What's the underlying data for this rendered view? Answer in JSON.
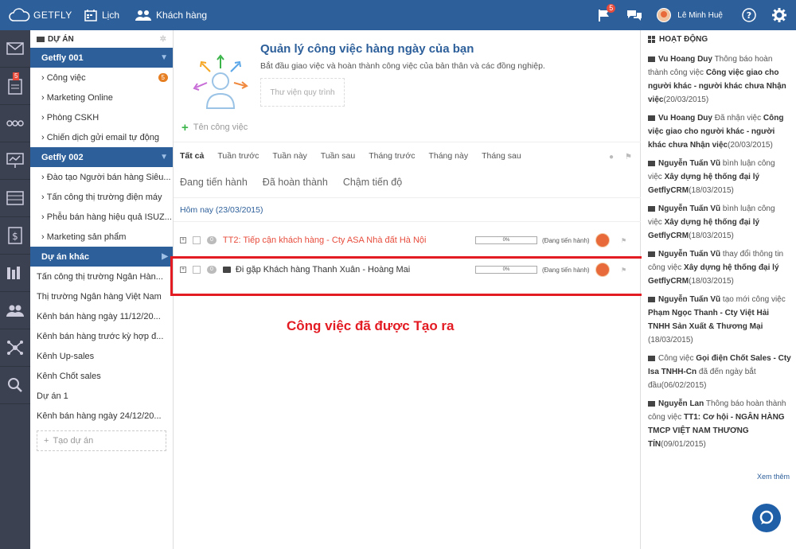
{
  "topbar": {
    "brand": "GETFLY",
    "nav": [
      {
        "label": "Lịch",
        "icon": "calendar-icon"
      },
      {
        "label": "Khách hàng",
        "icon": "customers-icon"
      }
    ],
    "flag_badge": "5",
    "user_name": "Lê Minh Huệ"
  },
  "rail": {
    "badge": "5"
  },
  "sidebar": {
    "title": "DỰ ÁN",
    "groups": [
      {
        "label": "Getfly 001",
        "items": [
          {
            "label": "Công việc",
            "count": "5"
          },
          {
            "label": "Marketing Online"
          },
          {
            "label": "Phòng CSKH"
          },
          {
            "label": "Chiến dịch gửi email tự động"
          }
        ]
      },
      {
        "label": "Getfly 002",
        "items": [
          {
            "label": "Đào tạo Người bán hàng Siêu..."
          },
          {
            "label": "Tấn công thị trường điện máy"
          },
          {
            "label": "Phễu bán hàng hiệu quả ISUZ..."
          },
          {
            "label": "Marketing sản phẩm"
          }
        ]
      },
      {
        "label": "Dự án khác",
        "items": [
          {
            "label": "Tấn công thị trường Ngân Hàn..."
          },
          {
            "label": "Thị trường Ngân hàng Việt Nam"
          },
          {
            "label": "Kênh bán hàng ngày 11/12/20..."
          },
          {
            "label": "Kênh bán hàng trước kỳ hợp đ..."
          },
          {
            "label": "Kênh Up-sales"
          },
          {
            "label": "Kênh Chốt sales"
          },
          {
            "label": "Dự án 1"
          },
          {
            "label": "Kênh bán hàng ngày 24/12/20..."
          }
        ]
      }
    ],
    "add_project": "Tạo dự án"
  },
  "main": {
    "hero_title": "Quản lý công việc hàng ngày của bạn",
    "hero_sub": "Bắt đầu giao việc và hoàn thành công việc của bản thân và các đồng nghiệp.",
    "hero_button": "Thư viện quy trình",
    "task_placeholder": "Tên công việc",
    "filter_tabs": [
      "Tất cả",
      "Tuần trước",
      "Tuần này",
      "Tuần sau",
      "Tháng trước",
      "Tháng này",
      "Tháng sau"
    ],
    "status_tabs": [
      "Đang tiến hành",
      "Đã hoàn thành",
      "Chậm tiến độ"
    ],
    "day_label": "Hôm nay (23/03/2015)",
    "tasks": [
      {
        "name": "TT2: Tiếp cận khách hàng - Cty ASA Nhà đất Hà Nội",
        "count": "0",
        "progress": "0%",
        "status": "(Đang tiến hành)",
        "color": "#e74c3c"
      },
      {
        "name": "Đi gặp Khách hàng Thanh Xuân - Hoàng Mai",
        "count": "0",
        "progress": "0%",
        "status": "(Đang tiến hành)",
        "color": "#333333"
      }
    ],
    "created_note": "Công việc đã được Tạo ra"
  },
  "activity": {
    "title": "HOẠT ĐỘNG",
    "items": [
      [
        {
          "t": "Vu Hoang Duy",
          "b": true
        },
        {
          "t": " Thông báo hoàn thành công việc "
        },
        {
          "t": "Công việc giao cho người khác - người khác chưa Nhận việc",
          "b": true
        },
        {
          "t": "(20/03/2015)"
        }
      ],
      [
        {
          "t": "Vu Hoang Duy",
          "b": true
        },
        {
          "t": " Đã nhận việc "
        },
        {
          "t": "Công việc giao cho người khác - người khác chưa Nhận việc",
          "b": true
        },
        {
          "t": "(20/03/2015)"
        }
      ],
      [
        {
          "t": "Nguyễn Tuấn Vũ",
          "b": true
        },
        {
          "t": " bình luận công việc "
        },
        {
          "t": "Xây dựng hệ thống đại lý GetflyCRM",
          "b": true
        },
        {
          "t": "(18/03/2015)"
        }
      ],
      [
        {
          "t": "Nguyễn Tuấn Vũ",
          "b": true
        },
        {
          "t": " bình luận công việc "
        },
        {
          "t": "Xây dựng hệ thống đại lý GetflyCRM",
          "b": true
        },
        {
          "t": "(18/03/2015)"
        }
      ],
      [
        {
          "t": "Nguyễn Tuấn Vũ",
          "b": true
        },
        {
          "t": " thay đổi thông tin công việc "
        },
        {
          "t": "Xây dựng hệ thống đại lý GetflyCRM",
          "b": true
        },
        {
          "t": "(18/03/2015)"
        }
      ],
      [
        {
          "t": "Nguyễn Tuấn Vũ",
          "b": true
        },
        {
          "t": " tạo mới công việc "
        },
        {
          "t": "Phạm Ngọc Thanh - Cty Việt Hải TNHH Sản Xuất & Thương Mại",
          "b": true
        },
        {
          "t": " (18/03/2015)"
        }
      ],
      [
        {
          "t": "Công việc "
        },
        {
          "t": "Gọi điện Chốt Sales - Cty Isa TNHH-Cn",
          "b": true
        },
        {
          "t": " đã đến ngày bắt đầu(06/02/2015)"
        }
      ],
      [
        {
          "t": "Nguyễn Lan",
          "b": true
        },
        {
          "t": " Thông báo hoàn thành công việc "
        },
        {
          "t": "TT1: Cơ hội - NGÂN HÀNG TMCP VIỆT NAM THƯƠNG TÍN",
          "b": true
        },
        {
          "t": "(09/01/2015)"
        }
      ]
    ],
    "more": "Xem thêm"
  }
}
